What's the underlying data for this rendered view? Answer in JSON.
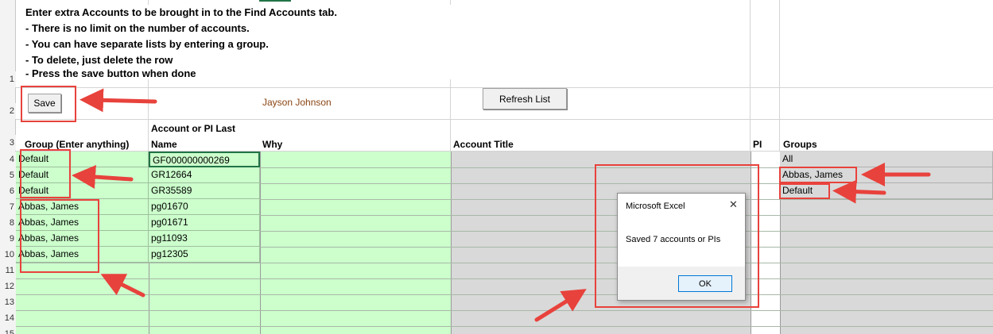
{
  "instructions": [
    "Enter extra Accounts to be brought in to the Find Accounts tab.",
    "- There is no limit on the number of accounts.",
    "- You can have separate lists by entering a group.",
    "- To delete, just delete the row",
    "- Press the save button when done"
  ],
  "buttons": {
    "save": "Save",
    "refresh": "Refresh List"
  },
  "user_name": "Jayson Johnson",
  "headers": {
    "group": "Group (Enter anything)",
    "account_line1": "Account or PI Last",
    "account_line2": "Name",
    "why": "Why",
    "title": "Account Title",
    "pi": "PI",
    "groups": "Groups"
  },
  "row_numbers": [
    "1",
    "2",
    "3",
    "4",
    "5",
    "6",
    "7",
    "8",
    "9",
    "10",
    "11",
    "12",
    "13",
    "14",
    "15"
  ],
  "rows": [
    {
      "group": "Default",
      "account": "GF000000000269"
    },
    {
      "group": "Default",
      "account": "GR12664"
    },
    {
      "group": "Default",
      "account": "GR35589"
    },
    {
      "group": "Abbas, James",
      "account": "pg01670"
    },
    {
      "group": "Abbas, James",
      "account": "pg01671"
    },
    {
      "group": "Abbas, James",
      "account": "pg11093"
    },
    {
      "group": "Abbas, James",
      "account": "pg12305"
    }
  ],
  "groups_list": [
    "All",
    "Abbas, James",
    "Default"
  ],
  "dialog": {
    "title": "Microsoft Excel",
    "close": "✕",
    "message": "Saved 7 accounts or PIs",
    "ok": "OK"
  },
  "colors": {
    "green": "#ccffcc",
    "gray": "#d9d9d9",
    "annotation_red": "#e8423c",
    "name_text": "#8b4513"
  }
}
